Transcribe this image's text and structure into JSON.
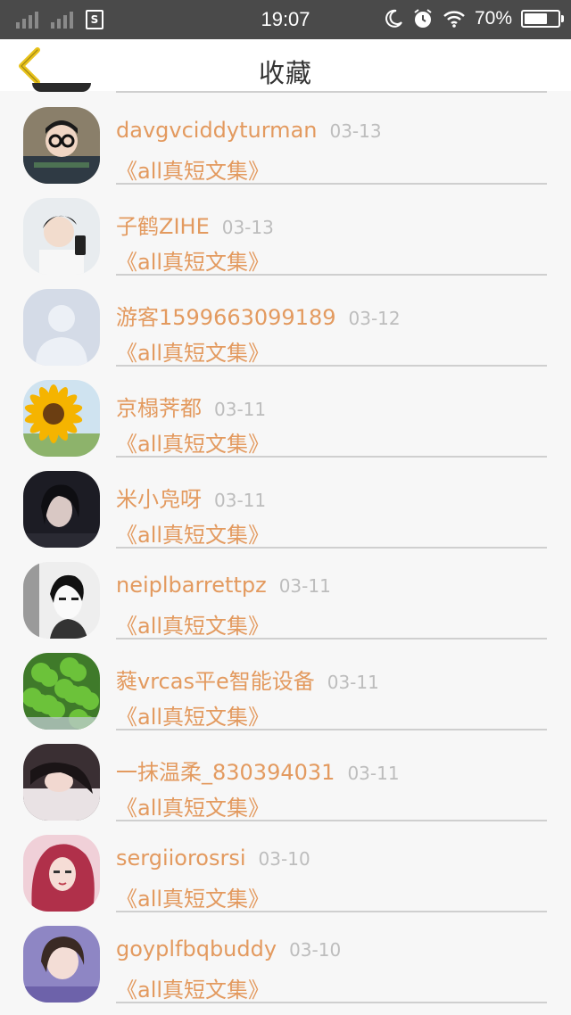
{
  "status_bar": {
    "time": "19:07",
    "battery_percent_text": "70%",
    "battery_level": 0.7,
    "sim_label": "S",
    "icons": [
      "signal-icon",
      "signal-icon",
      "sim-icon",
      "moon-icon",
      "alarm-icon",
      "wifi-icon",
      "battery-icon"
    ]
  },
  "header": {
    "title": "收藏",
    "back_icon": "chevron-left-icon",
    "accent_color": "#e8c21a"
  },
  "favorites": [
    {
      "user": "davgvciddyturman",
      "date": "03-13",
      "title": "《all真短文集》",
      "avatar": "boy-glasses"
    },
    {
      "user": "子鹤ZIHE",
      "date": "03-13",
      "title": "《all真短文集》",
      "avatar": "boy-phone"
    },
    {
      "user": "游客1599663099189",
      "date": "03-12",
      "title": "《all真短文集》",
      "avatar": "default-silhouette"
    },
    {
      "user": "京榻荠都",
      "date": "03-11",
      "title": "《all真短文集》",
      "avatar": "sunflower"
    },
    {
      "user": "米小凫呀",
      "date": "03-11",
      "title": "《all真短文集》",
      "avatar": "girl-dark"
    },
    {
      "user": "neiplbarrettpz",
      "date": "03-11",
      "title": "《all真短文集》",
      "avatar": "bw-portrait"
    },
    {
      "user": "蕤vrcas平e智能设备",
      "date": "03-11",
      "title": "《all真短文集》",
      "avatar": "clover"
    },
    {
      "user": "一抹温柔_830394031",
      "date": "03-11",
      "title": "《all真短文集》",
      "avatar": "girl-lying"
    },
    {
      "user": "sergiiorosrsi",
      "date": "03-10",
      "title": "《all真短文集》",
      "avatar": "girl-red-hair"
    },
    {
      "user": "goyplfbqbuddy",
      "date": "03-10",
      "title": "《all真短文集》",
      "avatar": "girl-purple"
    }
  ],
  "colors": {
    "accent_text": "#e39a5f",
    "date_text": "#bdbdbd",
    "status_bar_bg": "#4a4a4a",
    "background": "#f7f7f7"
  }
}
